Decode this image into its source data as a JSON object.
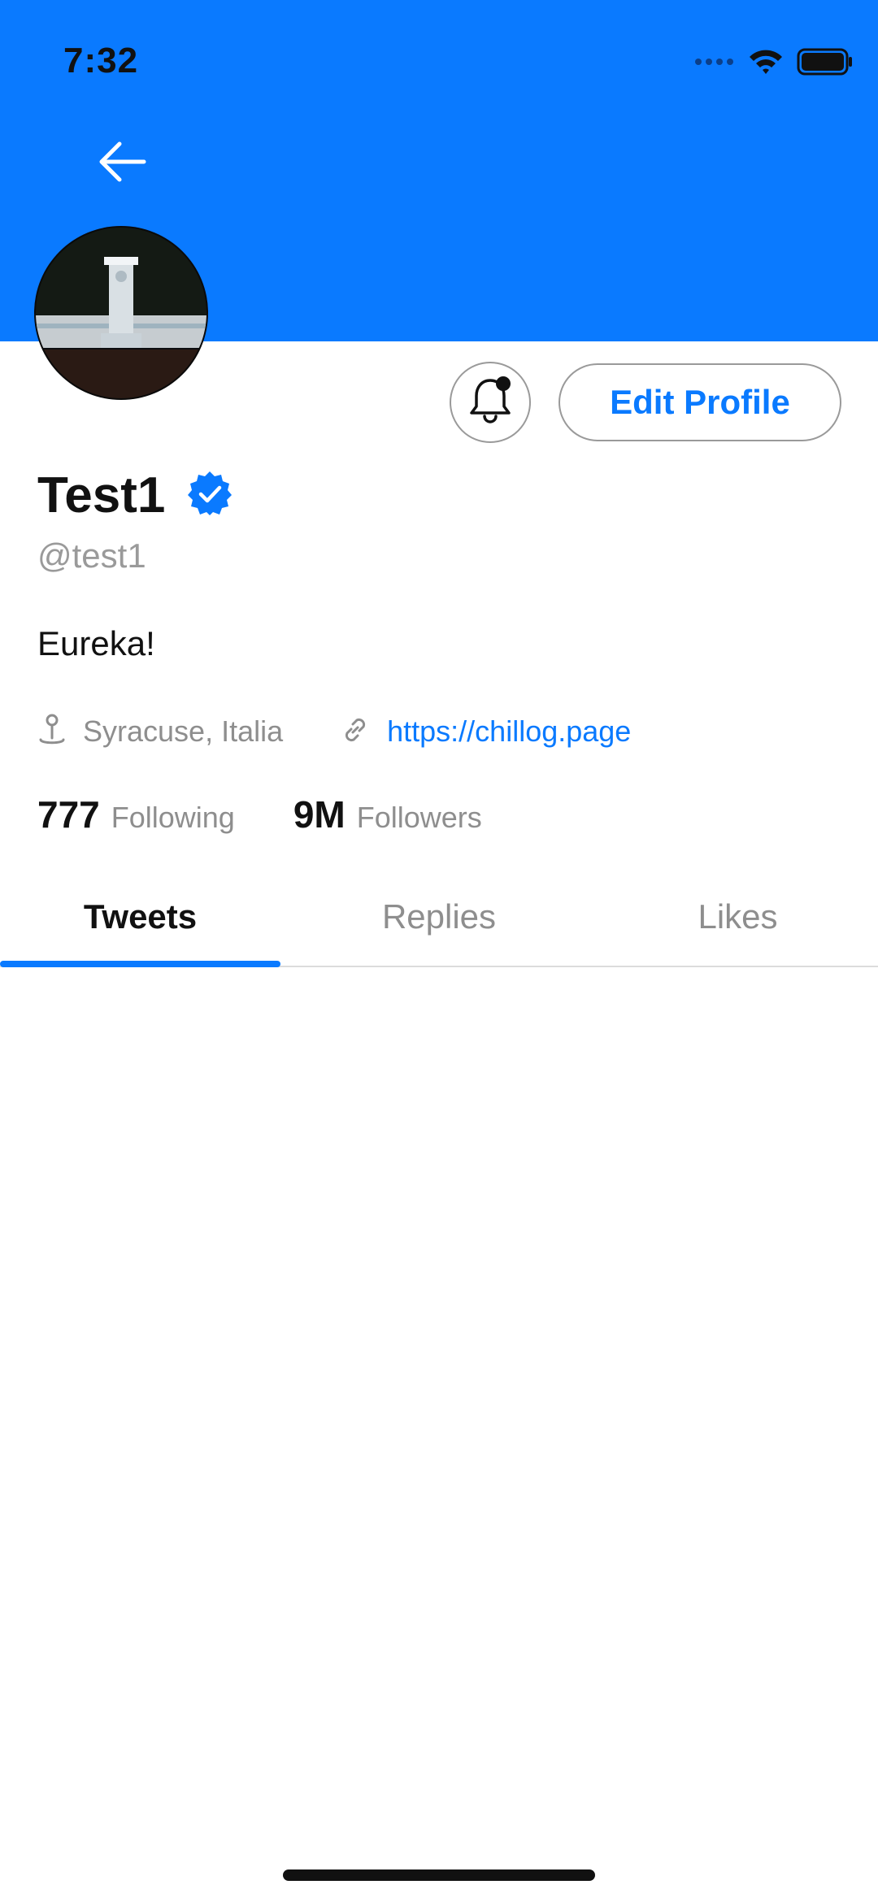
{
  "status_bar": {
    "time": "7:32",
    "icons": [
      "signal-dots-icon",
      "wifi-icon",
      "battery-icon"
    ]
  },
  "header": {
    "banner_color": "#0A7AFF",
    "back_icon": "arrow-left-icon"
  },
  "profile": {
    "display_name": "Test1",
    "verified": true,
    "handle": "@test1",
    "bio": "Eureka!",
    "location": "Syracuse, Italia",
    "website": "https://chillog.page",
    "following_count": "777",
    "following_label": "Following",
    "followers_count": "9M",
    "followers_label": "Followers"
  },
  "actions": {
    "notify_icon": "bell-icon",
    "edit_profile_label": "Edit Profile"
  },
  "tabs": [
    {
      "label": "Tweets",
      "active": true
    },
    {
      "label": "Replies",
      "active": false
    },
    {
      "label": "Likes",
      "active": false
    }
  ],
  "colors": {
    "accent": "#0A7AFF",
    "text_primary": "#111111",
    "text_secondary": "#8E8E8E"
  }
}
